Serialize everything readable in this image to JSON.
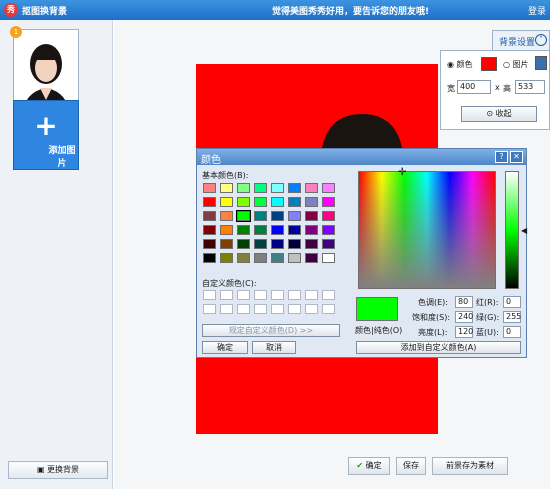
{
  "titlebar": {
    "title": "抠图换背景",
    "message": "觉得美图秀秀好用，要告诉您的朋友哦!",
    "login": "登录",
    "icon": "meitu-logo-icon"
  },
  "left": {
    "add_label": "添加图片",
    "change_bg_label": "更换背景",
    "thumb_badge": "1"
  },
  "bg_settings": {
    "tab_label": "背景设置",
    "radio_color": "颜色",
    "radio_image": "图片",
    "width_label": "宽",
    "width_value": "400",
    "times": "x",
    "height_label": "高",
    "height_value": "533",
    "collapse_label": "收起",
    "selected_color": "#ff0000"
  },
  "bottom": {
    "confirm_label": "确定",
    "save_label": "保存",
    "save_as_label": "前景存为素材"
  },
  "dialog": {
    "title": "颜色",
    "basic_label": "基本颜色(B):",
    "custom_label": "自定义颜色(C):",
    "define_custom_label": "规定自定义颜色(D) >>",
    "ok_label": "确定",
    "cancel_label": "取消",
    "color_solid_label": "颜色|纯色(O)",
    "add_custom_label": "添加到自定义颜色(A)",
    "hue_label": "色调(E):",
    "hue": "80",
    "sat_label": "饱和度(S):",
    "sat": "240",
    "lum_label": "亮度(L):",
    "lum": "120",
    "red_label": "红(R):",
    "red": "0",
    "green_label": "绿(G):",
    "green": "255",
    "blue_label": "蓝(U):",
    "blue": "0",
    "preview_color": "#00ff00",
    "basic_colors": [
      "#ff8080",
      "#ffff80",
      "#80ff80",
      "#00ff80",
      "#80ffff",
      "#0080ff",
      "#ff80c0",
      "#ff80ff",
      "#ff0000",
      "#ffff00",
      "#80ff00",
      "#00ff40",
      "#00ffff",
      "#0080c0",
      "#8080c0",
      "#ff00ff",
      "#804040",
      "#ff8040",
      "#00ff00",
      "#008080",
      "#004080",
      "#8080ff",
      "#800040",
      "#ff0080",
      "#800000",
      "#ff8000",
      "#008000",
      "#008040",
      "#0000ff",
      "#0000a0",
      "#800080",
      "#8000ff",
      "#400000",
      "#804000",
      "#004000",
      "#004040",
      "#000080",
      "#000040",
      "#400040",
      "#400080",
      "#000000",
      "#808000",
      "#808040",
      "#808080",
      "#408080",
      "#c0c0c0",
      "#400040",
      "#ffffff"
    ]
  }
}
